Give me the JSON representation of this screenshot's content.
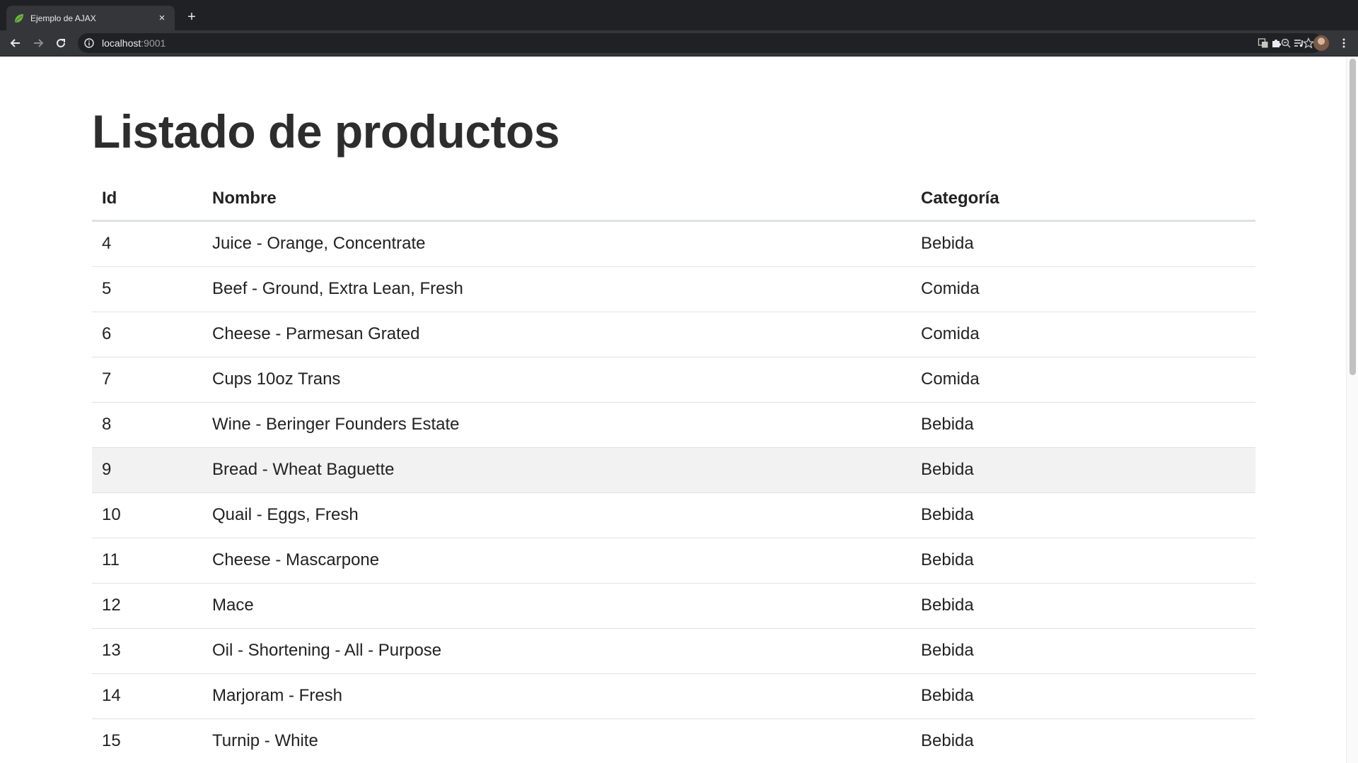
{
  "browser": {
    "tab_title": "Ejemplo de AJAX",
    "tab_close": "×",
    "new_tab": "+",
    "url_host": "localhost",
    "url_port": ":9001"
  },
  "page": {
    "title": "Listado de productos",
    "columns": [
      "Id",
      "Nombre",
      "Categoría"
    ],
    "rows": [
      {
        "id": "4",
        "name": "Juice - Orange, Concentrate",
        "category": "Bebida"
      },
      {
        "id": "5",
        "name": "Beef - Ground, Extra Lean, Fresh",
        "category": "Comida"
      },
      {
        "id": "6",
        "name": "Cheese - Parmesan Grated",
        "category": "Comida"
      },
      {
        "id": "7",
        "name": "Cups 10oz Trans",
        "category": "Comida"
      },
      {
        "id": "8",
        "name": "Wine - Beringer Founders Estate",
        "category": "Bebida"
      },
      {
        "id": "9",
        "name": "Bread - Wheat Baguette",
        "category": "Bebida"
      },
      {
        "id": "10",
        "name": "Quail - Eggs, Fresh",
        "category": "Bebida"
      },
      {
        "id": "11",
        "name": "Cheese - Mascarpone",
        "category": "Bebida"
      },
      {
        "id": "12",
        "name": "Mace",
        "category": "Bebida"
      },
      {
        "id": "13",
        "name": "Oil - Shortening - All - Purpose",
        "category": "Bebida"
      },
      {
        "id": "14",
        "name": "Marjoram - Fresh",
        "category": "Bebida"
      },
      {
        "id": "15",
        "name": "Turnip - White",
        "category": "Bebida"
      }
    ]
  }
}
